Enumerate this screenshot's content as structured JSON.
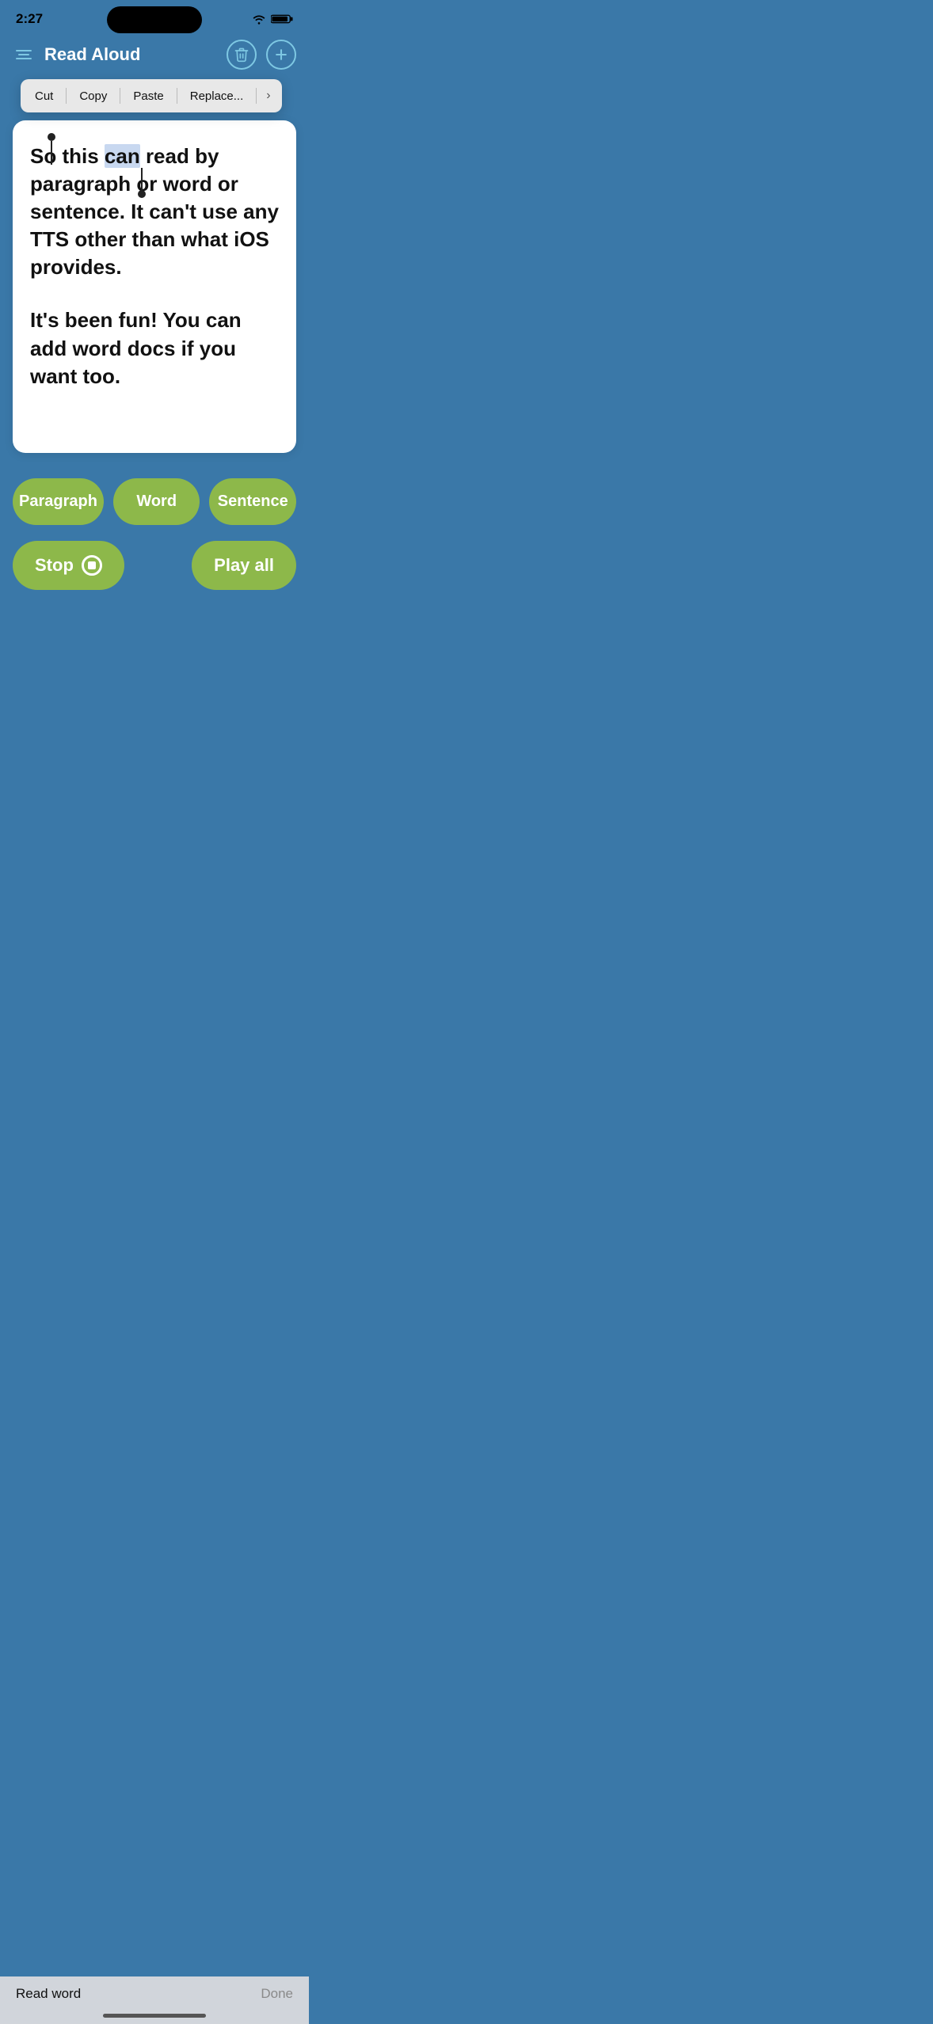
{
  "statusBar": {
    "time": "2:27"
  },
  "navBar": {
    "title": "Read Aloud"
  },
  "contextMenu": {
    "items": [
      "Cut",
      "Copy",
      "Paste",
      "Replace..."
    ],
    "arrowLabel": "›"
  },
  "textCard": {
    "paragraph1": "So this can read by paragraph or word or sentence. It can't use any TTS other than what iOS provides.",
    "highlightedWord": "can",
    "paragraph2": "It's been fun! You can add word docs if you want too."
  },
  "modeButtons": {
    "paragraph": "Paragraph",
    "word": "Word",
    "sentence": "Sentence"
  },
  "actionButtons": {
    "stop": "Stop",
    "playAll": "Play all"
  },
  "keyboardBar": {
    "label": "Read word",
    "done": "Done"
  }
}
